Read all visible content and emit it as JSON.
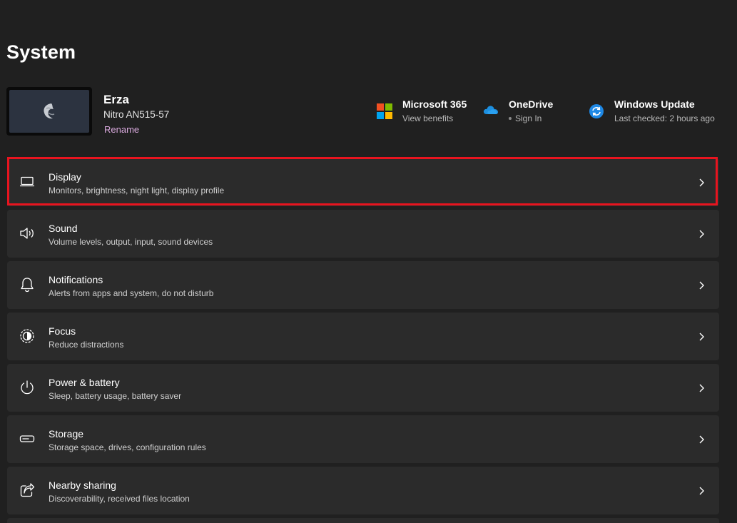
{
  "page": {
    "title": "System"
  },
  "device": {
    "name": "Erza",
    "model": "Nitro AN515-57",
    "rename_label": "Rename"
  },
  "quick_links": [
    {
      "title": "Microsoft 365",
      "subtitle": "View benefits",
      "icon": "microsoft-logo-icon"
    },
    {
      "title": "OneDrive",
      "subtitle": "Sign In",
      "icon": "onedrive-cloud-icon"
    },
    {
      "title": "Windows Update",
      "subtitle": "Last checked: 2 hours ago",
      "icon": "windows-update-icon"
    }
  ],
  "settings": [
    {
      "title": "Display",
      "description": "Monitors, brightness, night light, display profile",
      "icon": "laptop-display-icon",
      "highlighted": true
    },
    {
      "title": "Sound",
      "description": "Volume levels, output, input, sound devices",
      "icon": "speaker-icon"
    },
    {
      "title": "Notifications",
      "description": "Alerts from apps and system, do not disturb",
      "icon": "bell-icon"
    },
    {
      "title": "Focus",
      "description": "Reduce distractions",
      "icon": "focus-icon"
    },
    {
      "title": "Power & battery",
      "description": "Sleep, battery usage, battery saver",
      "icon": "power-icon"
    },
    {
      "title": "Storage",
      "description": "Storage space, drives, configuration rules",
      "icon": "storage-drive-icon"
    },
    {
      "title": "Nearby sharing",
      "description": "Discoverability, received files location",
      "icon": "share-icon"
    }
  ],
  "colors": {
    "background": "#202020",
    "card": "#2b2b2b",
    "accent_link": "#d9a9dd",
    "highlight_border": "#e8141f"
  }
}
